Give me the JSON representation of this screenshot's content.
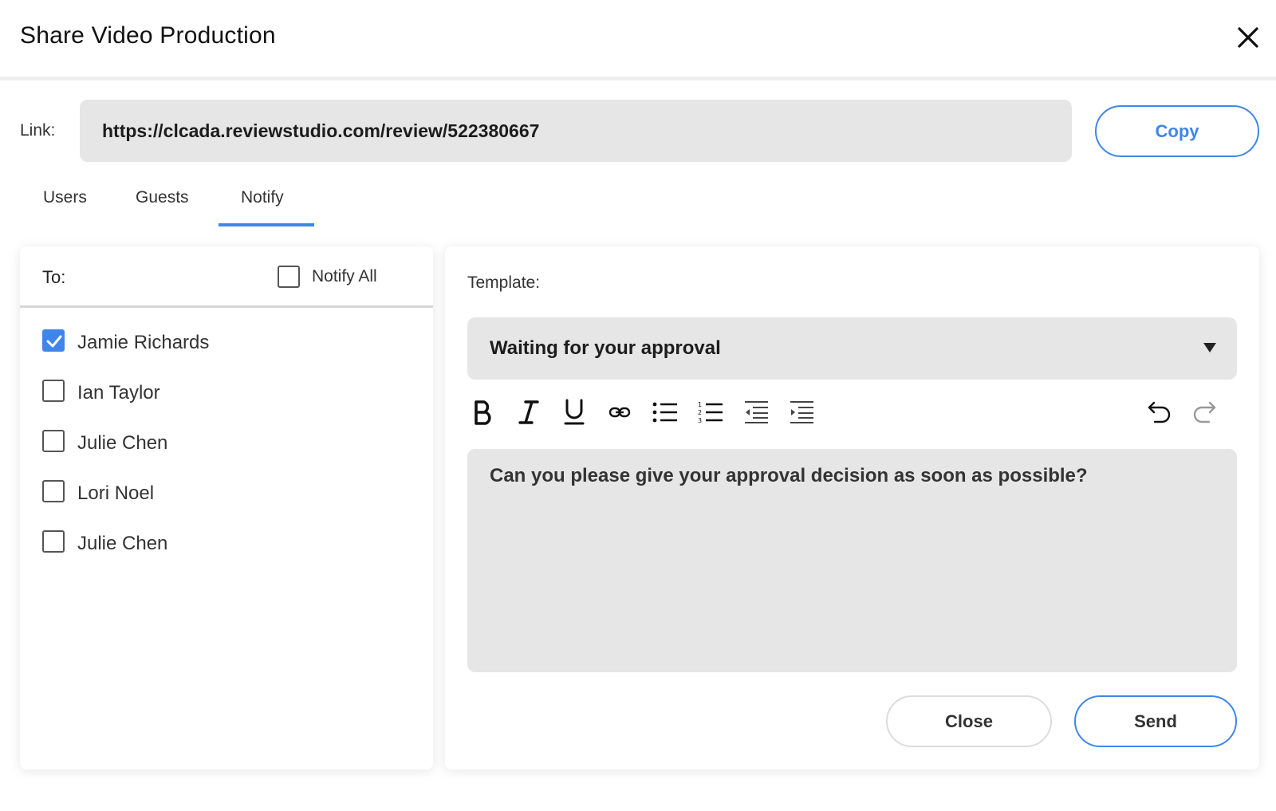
{
  "dialog": {
    "title": "Share Video Production",
    "close_icon": "close-icon"
  },
  "link": {
    "label": "Link:",
    "url": "https://clcada.reviewstudio.com/review/522380667",
    "copy_label": "Copy"
  },
  "tabs": [
    {
      "label": "Users",
      "active": false
    },
    {
      "label": "Guests",
      "active": false
    },
    {
      "label": "Notify",
      "active": true
    }
  ],
  "recipients": {
    "to_label": "To:",
    "notify_all_label": "Notify All",
    "notify_all_checked": false,
    "users": [
      {
        "name": "Jamie Richards",
        "checked": true
      },
      {
        "name": "Ian Taylor",
        "checked": false
      },
      {
        "name": "Julie Chen",
        "checked": false
      },
      {
        "name": "Lori Noel",
        "checked": false
      },
      {
        "name": "Julie Chen",
        "checked": false
      }
    ]
  },
  "message": {
    "template_label": "Template:",
    "template_value": "Waiting for your approval",
    "toolbar": [
      "bold-icon",
      "italic-icon",
      "underline-icon",
      "link-icon",
      "bulleted-list-icon",
      "numbered-list-icon",
      "outdent-icon",
      "indent-icon",
      "undo-icon",
      "redo-icon"
    ],
    "body": "Can you please give your approval decision as soon as possible?"
  },
  "actions": {
    "close_label": "Close",
    "send_label": "Send"
  },
  "colors": {
    "accent": "#3f86ea",
    "field_bg": "#e6e6e6"
  }
}
